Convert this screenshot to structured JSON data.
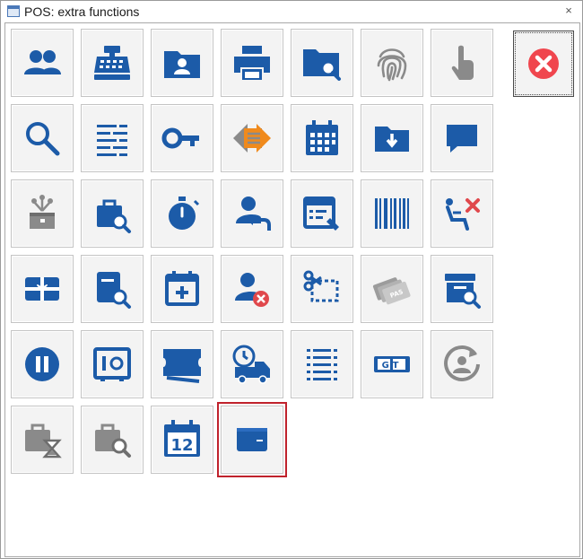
{
  "window": {
    "title": "POS: extra functions",
    "close_glyph": "×"
  },
  "colors": {
    "icon_blue": "#1c5ba8",
    "icon_gray": "#8a8a8a",
    "accent_orange": "#f08a1c",
    "exit_red": "#f0464e",
    "selection_outline": "#c0222c"
  },
  "exit_button": {
    "icon": "close-circle-icon"
  },
  "tiles": [
    {
      "icon": "users-icon"
    },
    {
      "icon": "cash-register-icon"
    },
    {
      "icon": "customer-folder-icon"
    },
    {
      "icon": "printer-icon"
    },
    {
      "icon": "folder-search-icon"
    },
    {
      "icon": "fingerprint-icon"
    },
    {
      "icon": "touch-hand-icon"
    },
    {
      "icon": "search-icon"
    },
    {
      "icon": "list-icon"
    },
    {
      "icon": "key-icon"
    },
    {
      "icon": "exchange-arrows-icon"
    },
    {
      "icon": "calendar-icon"
    },
    {
      "icon": "folder-download-icon"
    },
    {
      "icon": "message-icon"
    },
    {
      "icon": "gift-box-icon"
    },
    {
      "icon": "bag-search-icon"
    },
    {
      "icon": "stopwatch-icon"
    },
    {
      "icon": "user-return-icon"
    },
    {
      "icon": "form-edit-icon"
    },
    {
      "icon": "barcode-icon"
    },
    {
      "icon": "seat-cancel-icon"
    },
    {
      "icon": "gift-card-icon"
    },
    {
      "icon": "document-search-icon"
    },
    {
      "icon": "calendar-add-icon"
    },
    {
      "icon": "user-remove-icon"
    },
    {
      "icon": "cut-coupon-icon"
    },
    {
      "icon": "loyalty-cards-icon",
      "label": "PAS"
    },
    {
      "icon": "archive-search-icon"
    },
    {
      "icon": "pause-icon"
    },
    {
      "icon": "safe-icon"
    },
    {
      "icon": "ticket-icon"
    },
    {
      "icon": "delivery-truck-icon"
    },
    {
      "icon": "checklist-icon"
    },
    {
      "icon": "gt-logo-icon",
      "label": "GT"
    },
    {
      "icon": "user-refresh-icon"
    },
    {
      "icon": "bag-hourglass-icon"
    },
    {
      "icon": "bag-search-gray-icon"
    },
    {
      "icon": "calendar-day-icon",
      "label": "12"
    },
    {
      "icon": "wallet-icon",
      "selected": true
    }
  ]
}
